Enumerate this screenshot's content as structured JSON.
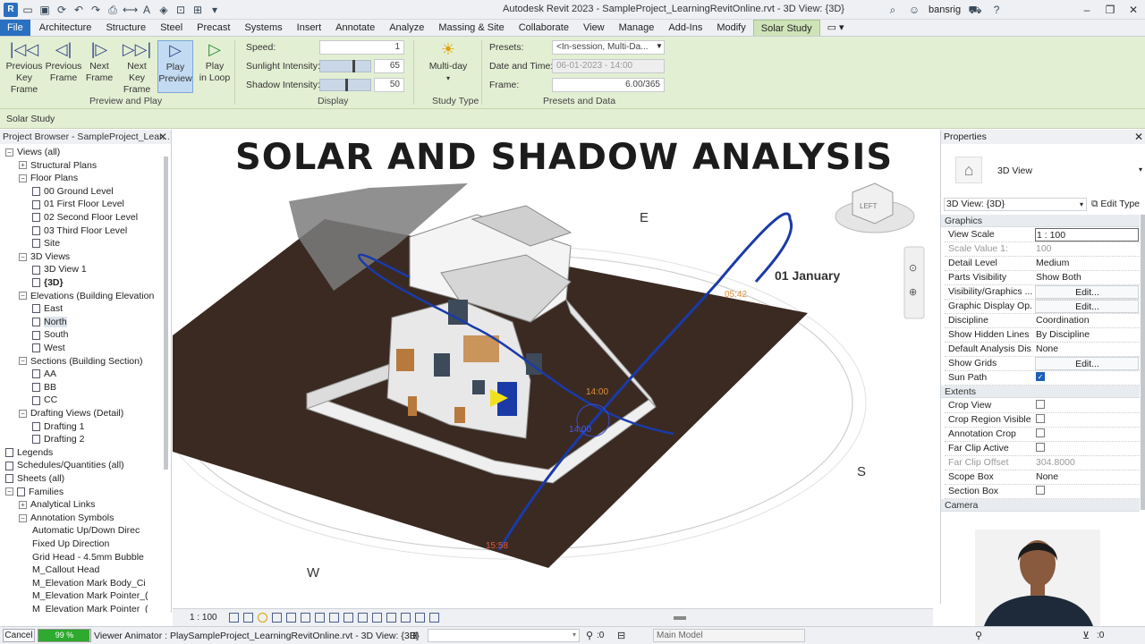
{
  "titlebar": {
    "title": "Autodesk Revit 2023 - SampleProject_LearningRevitOnline.rvt - 3D View: {3D}",
    "user": "bansrig"
  },
  "tabs": [
    "File",
    "Architecture",
    "Structure",
    "Steel",
    "Precast",
    "Systems",
    "Insert",
    "Annotate",
    "Analyze",
    "Massing & Site",
    "Collaborate",
    "View",
    "Manage",
    "Add-Ins",
    "Modify",
    "Solar Study"
  ],
  "ribbon": {
    "buttons": [
      {
        "label1": "Previous",
        "label2": "Key Frame",
        "icon": "previous-key-frame-icon",
        "glyph": "|◁◁"
      },
      {
        "label1": "Previous",
        "label2": "Frame",
        "icon": "previous-frame-icon",
        "glyph": "◁|"
      },
      {
        "label1": "Next",
        "label2": "Frame",
        "icon": "next-frame-icon",
        "glyph": "|▷"
      },
      {
        "label1": "Next",
        "label2": "Key Frame",
        "icon": "next-key-frame-icon",
        "glyph": "▷▷|"
      },
      {
        "label1": "Play",
        "label2": "Preview",
        "icon": "play-preview-icon",
        "glyph": "▷"
      },
      {
        "label1": "Play",
        "label2": "in Loop",
        "icon": "play-loop-icon",
        "glyph": "▷"
      }
    ],
    "preview_panel_label": "Preview and Play",
    "display": {
      "speed_label": "Speed:",
      "speed_value": "1",
      "sunlight_label": "Sunlight Intensity:",
      "sunlight_value": "65",
      "shadow_label": "Shadow Intensity:",
      "shadow_value": "50",
      "panel_label": "Display",
      "sunlight_fraction": 0.65,
      "shadow_fraction": 0.5
    },
    "study_type": {
      "label": "Multi-day",
      "panel_label": "Study Type"
    },
    "presets": {
      "presets_label": "Presets:",
      "presets_value": "<In-session, Multi-Da...",
      "datetime_label": "Date and Time:",
      "datetime_value": "06-01-2023 - 14:00",
      "frame_label": "Frame:",
      "frame_value": "6.00/365",
      "panel_label": "Presets and Data"
    }
  },
  "context_bar": "Solar Study",
  "browser": {
    "title": "Project Browser - SampleProject_Lear...",
    "items": [
      {
        "label": "Views (all)",
        "level": 0,
        "toggle": "−",
        "icon": false
      },
      {
        "label": "Structural Plans",
        "level": 1,
        "toggle": "+",
        "icon": false
      },
      {
        "label": "Floor Plans",
        "level": 1,
        "toggle": "−",
        "icon": false
      },
      {
        "label": "00 Ground Level",
        "level": 2,
        "toggle": "",
        "icon": true
      },
      {
        "label": "01 First Floor Level",
        "level": 2,
        "toggle": "",
        "icon": true
      },
      {
        "label": "02 Second Floor Level",
        "level": 2,
        "toggle": "",
        "icon": true
      },
      {
        "label": "03 Third Floor Level",
        "level": 2,
        "toggle": "",
        "icon": true
      },
      {
        "label": "Site",
        "level": 2,
        "toggle": "",
        "icon": true
      },
      {
        "label": "3D Views",
        "level": 1,
        "toggle": "−",
        "icon": false
      },
      {
        "label": "3D View 1",
        "level": 2,
        "toggle": "",
        "icon": true
      },
      {
        "label": "{3D}",
        "level": 2,
        "toggle": "",
        "icon": true,
        "bold": true
      },
      {
        "label": "Elevations (Building Elevation",
        "level": 1,
        "toggle": "−",
        "icon": false
      },
      {
        "label": "East",
        "level": 2,
        "toggle": "",
        "icon": true
      },
      {
        "label": "North",
        "level": 2,
        "toggle": "",
        "icon": true,
        "selected": true
      },
      {
        "label": "South",
        "level": 2,
        "toggle": "",
        "icon": true
      },
      {
        "label": "West",
        "level": 2,
        "toggle": "",
        "icon": true
      },
      {
        "label": "Sections (Building Section)",
        "level": 1,
        "toggle": "−",
        "icon": false
      },
      {
        "label": "AA",
        "level": 2,
        "toggle": "",
        "icon": true
      },
      {
        "label": "BB",
        "level": 2,
        "toggle": "",
        "icon": true
      },
      {
        "label": "CC",
        "level": 2,
        "toggle": "",
        "icon": true
      },
      {
        "label": "Drafting Views (Detail)",
        "level": 1,
        "toggle": "−",
        "icon": false
      },
      {
        "label": "Drafting 1",
        "level": 2,
        "toggle": "",
        "icon": true
      },
      {
        "label": "Drafting 2",
        "level": 2,
        "toggle": "",
        "icon": true
      },
      {
        "label": "Legends",
        "level": 0,
        "toggle": "",
        "icon": true
      },
      {
        "label": "Schedules/Quantities (all)",
        "level": 0,
        "toggle": "",
        "icon": true
      },
      {
        "label": "Sheets (all)",
        "level": 0,
        "toggle": "",
        "icon": true
      },
      {
        "label": "Families",
        "level": 0,
        "toggle": "−",
        "icon": true
      },
      {
        "label": "Analytical Links",
        "level": 1,
        "toggle": "+",
        "icon": false
      },
      {
        "label": "Annotation Symbols",
        "level": 1,
        "toggle": "−",
        "icon": false
      },
      {
        "label": "Automatic Up/Down Direc",
        "level": 2,
        "toggle": "",
        "icon": false
      },
      {
        "label": "Fixed Up Direction",
        "level": 2,
        "toggle": "",
        "icon": false
      },
      {
        "label": "Grid Head - 4.5mm Bubble",
        "level": 2,
        "toggle": "",
        "icon": false
      },
      {
        "label": "M_Callout Head",
        "level": 2,
        "toggle": "",
        "icon": false
      },
      {
        "label": "M_Elevation Mark Body_Ci",
        "level": 2,
        "toggle": "",
        "icon": false
      },
      {
        "label": "M_Elevation Mark Pointer_(",
        "level": 2,
        "toggle": "",
        "icon": false
      },
      {
        "label": "M_Elevation Mark Pointer_(",
        "level": 2,
        "toggle": "",
        "icon": false
      }
    ]
  },
  "viewport": {
    "headline": "SOLAR AND SHADOW ANALYSIS",
    "compass": {
      "e": "E",
      "s": "S",
      "w": "W"
    },
    "date_label": "01 January",
    "time_labels": [
      "05:42",
      "14:00",
      "14:00",
      "15:58"
    ],
    "viewcube_label": "LEFT"
  },
  "viewbar": {
    "scale": "1 : 100"
  },
  "properties": {
    "title": "Properties",
    "type_name": "3D View",
    "selector": "3D View: {3D}",
    "edit_type": "Edit Type",
    "sections": [
      {
        "name": "Graphics",
        "rows": [
          {
            "k": "View Scale",
            "v": "1 : 100",
            "kind": "input"
          },
          {
            "k": "Scale Value    1:",
            "v": "100",
            "kind": "dim"
          },
          {
            "k": "Detail Level",
            "v": "Medium",
            "kind": "text"
          },
          {
            "k": "Parts Visibility",
            "v": "Show Both",
            "kind": "text"
          },
          {
            "k": "Visibility/Graphics ...",
            "v": "Edit...",
            "kind": "btn"
          },
          {
            "k": "Graphic Display Op...",
            "v": "Edit...",
            "kind": "btn"
          },
          {
            "k": "Discipline",
            "v": "Coordination",
            "kind": "text"
          },
          {
            "k": "Show Hidden Lines",
            "v": "By Discipline",
            "kind": "text"
          },
          {
            "k": "Default Analysis Dis...",
            "v": "None",
            "kind": "text"
          },
          {
            "k": "Show Grids",
            "v": "Edit...",
            "kind": "btn"
          },
          {
            "k": "Sun Path",
            "v": "",
            "kind": "check-on"
          }
        ]
      },
      {
        "name": "Extents",
        "rows": [
          {
            "k": "Crop View",
            "v": "",
            "kind": "check"
          },
          {
            "k": "Crop Region Visible",
            "v": "",
            "kind": "check"
          },
          {
            "k": "Annotation Crop",
            "v": "",
            "kind": "check"
          },
          {
            "k": "Far Clip Active",
            "v": "",
            "kind": "check"
          },
          {
            "k": "Far Clip Offset",
            "v": "304.8000",
            "kind": "dim"
          },
          {
            "k": "Scope Box",
            "v": "None",
            "kind": "text"
          },
          {
            "k": "Section Box",
            "v": "",
            "kind": "check"
          }
        ]
      },
      {
        "name": "Camera",
        "rows": []
      }
    ]
  },
  "statusbar": {
    "cancel": "Cancel",
    "progress_text": "99 %",
    "progress_fraction": 0.99,
    "status": "Viewer Animator : PlaySampleProject_LearningRevitOnline.rvt - 3D View: {3D}",
    "zero": ":0",
    "workset": "Main Model"
  },
  "colors": {
    "ribbon_bg": "#e3efd3",
    "file_tab": "#2a70c0",
    "sun_path": "#1a3aa8",
    "ground_shadow": "#3a2a22"
  }
}
